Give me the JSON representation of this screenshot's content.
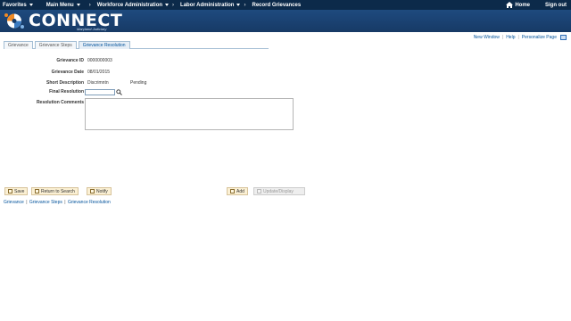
{
  "topnav": {
    "favorites": "Favorites",
    "main_menu": "Main Menu",
    "breadcrumbs": [
      "Workforce Administration",
      "Labor Administration",
      "Record Grievances"
    ],
    "home": "Home",
    "sign_out": "Sign out"
  },
  "banner": {
    "logo_text": "CONNECT",
    "logo_sub": "Maryland Judiciary"
  },
  "utility_links": {
    "new_window": "New Window",
    "help": "Help",
    "personalize": "Personalize Page"
  },
  "tabs": [
    {
      "label": "Grievance",
      "active": false
    },
    {
      "label": "Grievance Steps",
      "active": false
    },
    {
      "label": "Grievance Resolution",
      "active": true
    }
  ],
  "form": {
    "grievance_id_label": "Grievance ID",
    "grievance_id_value": "0000000003",
    "grievance_date_label": "Grievance Date",
    "grievance_date_value": "08/01/2015",
    "short_description_label": "Short Description",
    "short_description_value": "Discrimntn",
    "status_value": "Pending",
    "final_resolution_label": "Final Resolution",
    "final_resolution_value": "",
    "resolution_comments_label": "Resolution Comments",
    "resolution_comments_value": ""
  },
  "toolbar": {
    "save": "Save",
    "return_to_search": "Return to Search",
    "notify": "Notify",
    "add": "Add",
    "update_display": "Update/Display"
  },
  "bottom_links": [
    "Grievance",
    "Grievance Steps",
    "Grievance Resolution"
  ],
  "colors": {
    "nav_bg": "#0c2a4a",
    "banner_bg": "#1e4a7e",
    "link": "#00529b",
    "button_bg": "#fbf0d4"
  }
}
